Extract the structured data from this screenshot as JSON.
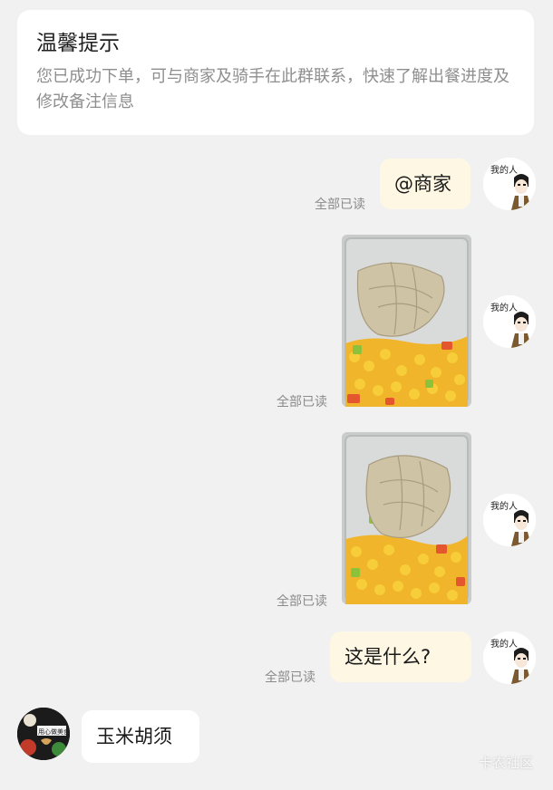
{
  "notice": {
    "title": "温馨提示",
    "body": "您已成功下单，可与商家及骑手在此群联系，快速了解出餐进度及修改备注信息"
  },
  "messages": [
    {
      "sender": "self",
      "type": "text",
      "text": "@商家",
      "read_status": "全部已读"
    },
    {
      "sender": "self",
      "type": "image",
      "image": "food-photo: mushroom strips over corn and carrot",
      "read_status": "全部已读"
    },
    {
      "sender": "self",
      "type": "image",
      "image": "food-photo: mushroom strips over corn and carrot",
      "read_status": "全部已读"
    },
    {
      "sender": "self",
      "type": "text",
      "text": "这是什么?",
      "read_status": "全部已读"
    },
    {
      "sender": "merchant",
      "type": "text",
      "text": "玉米胡须"
    }
  ],
  "avatars": {
    "self_caption": "我的人",
    "merchant_caption": "用心做美食"
  },
  "colors": {
    "background": "#f1f1f1",
    "self_bubble": "#fdf7e3",
    "other_bubble": "#ffffff",
    "muted_text": "#8a8a8a"
  },
  "watermark": "卡农社区"
}
